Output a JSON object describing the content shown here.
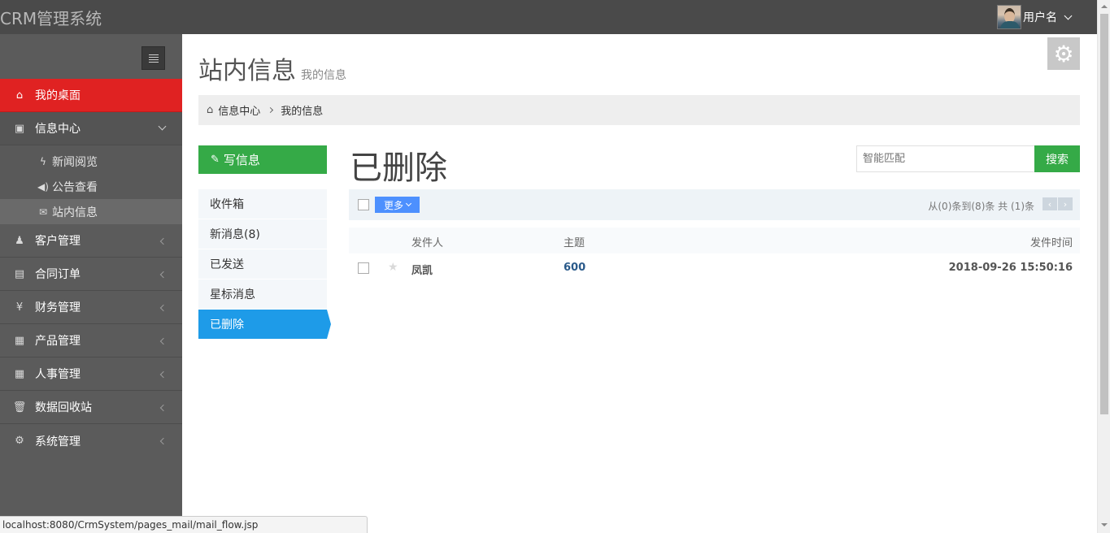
{
  "app": {
    "brand": "CRM管理系统",
    "user_name": "用户名"
  },
  "sidebar": {
    "items": [
      {
        "label": "我的桌面",
        "icon": "home-icon"
      },
      {
        "label": "信息中心",
        "icon": "message-icon"
      },
      {
        "label": "客户管理",
        "icon": "user-icon"
      },
      {
        "label": "合同订单",
        "icon": "book-icon"
      },
      {
        "label": "财务管理",
        "icon": "yen-icon"
      },
      {
        "label": "产品管理",
        "icon": "table-icon"
      },
      {
        "label": "人事管理",
        "icon": "table-icon"
      },
      {
        "label": "数据回收站",
        "icon": "trash-icon"
      },
      {
        "label": "系统管理",
        "icon": "gear-icon"
      }
    ],
    "submenu": [
      {
        "label": "新闻阅览",
        "icon": "bolt-icon"
      },
      {
        "label": "公告查看",
        "icon": "volume-icon"
      },
      {
        "label": "站内信息",
        "icon": "envelope-icon"
      }
    ]
  },
  "page": {
    "title": "站内信息",
    "subtitle": "我的信息"
  },
  "breadcrumb": {
    "home": "信息中心",
    "current": "我的信息"
  },
  "mail": {
    "compose_label": "写信息",
    "folders": [
      "收件箱",
      "新消息(8)",
      "已发送",
      "星标消息",
      "已删除"
    ],
    "active_folder_title": "已删除",
    "search_placeholder": "智能匹配",
    "search_button": "搜索",
    "more_label": "更多",
    "pager_text": "从(0)条到(8)条 共 (1)条",
    "columns": {
      "sender": "发件人",
      "subject": "主题",
      "time": "发件时间"
    },
    "rows": [
      {
        "sender": "凤凯",
        "subject": "600",
        "time": "2018-09-26 15:50:16"
      }
    ]
  },
  "status_url": "localhost:8080/CrmSystem/pages_mail/mail_flow.jsp",
  "colors": {
    "accent_red": "#e02222",
    "green": "#35aa47",
    "blue": "#1e9be8",
    "sidebar": "#5b5b5b",
    "topbar": "#4a4a4a"
  }
}
